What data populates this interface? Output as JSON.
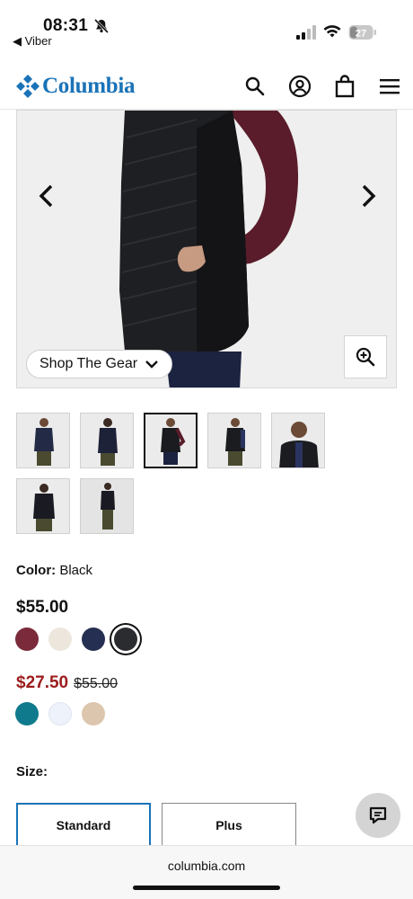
{
  "status_bar": {
    "time": "08:31",
    "back_app": "◀ Viber",
    "battery": "27"
  },
  "header": {
    "brand": "Columbia",
    "brand_color": "#1a73b8",
    "icons": [
      "search-icon",
      "account-icon",
      "bag-icon",
      "menu-icon"
    ]
  },
  "hero": {
    "shop_button": "Shop The Gear",
    "prev_icon": "chevron-left-icon",
    "next_icon": "chevron-right-icon",
    "zoom_icon": "zoom-in-icon"
  },
  "thumbnails": {
    "count": 7,
    "selected_index": 2
  },
  "color": {
    "label": "Color:",
    "value": "Black"
  },
  "regular": {
    "price": "$55.00",
    "swatches": [
      "#7a2a3a",
      "#ede6dd",
      "#242f52",
      "#2b2c30"
    ],
    "selected_index": 3
  },
  "sale": {
    "price": "$27.50",
    "was": "$55.00",
    "sale_color": "#9b1c1c",
    "swatches": [
      "#0f7a8c",
      "#eef2fb",
      "#dcc6ad"
    ]
  },
  "size": {
    "label": "Size:",
    "options": [
      "Standard",
      "Plus"
    ],
    "selected_index": 0
  },
  "browser": {
    "url": "columbia.com"
  }
}
